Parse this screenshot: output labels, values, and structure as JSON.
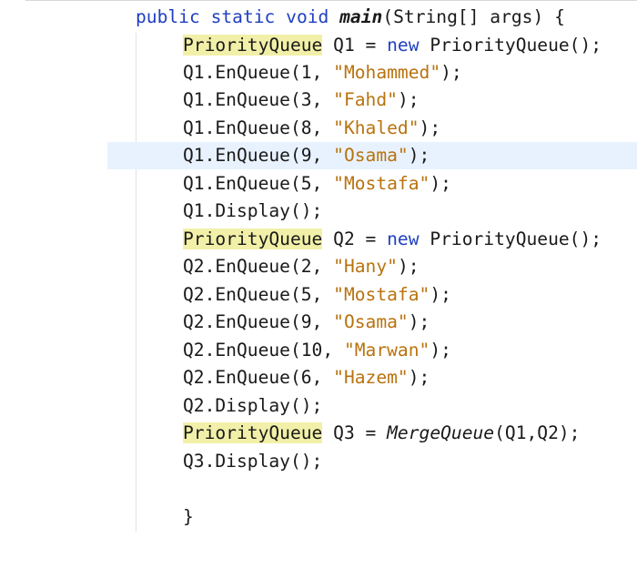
{
  "colors": {
    "keyword": "#1f3fbf",
    "string": "#b8730e",
    "type_highlight": "#f2f0a8",
    "current_line": "#e8f2fe",
    "text": "#1a1a1a"
  },
  "code": {
    "l1": {
      "a": "public static void ",
      "b": "main",
      "c": "(String[] args) {"
    },
    "l2": {
      "a": "PriorityQueue",
      "b": " Q1 = ",
      "c": "new",
      "d": " PriorityQueue();"
    },
    "l3": {
      "a": "Q1.EnQueue(1, ",
      "b": "\"Mohammed\"",
      "c": ");"
    },
    "l4": {
      "a": "Q1.EnQueue(3, ",
      "b": "\"Fahd\"",
      "c": ");"
    },
    "l5": {
      "a": "Q1.EnQueue(8, ",
      "b": "\"Khaled\"",
      "c": ");"
    },
    "l6": {
      "a": "Q1.EnQueue(9, ",
      "b": "\"Osama\"",
      "c": ");"
    },
    "l7": {
      "a": "Q1.EnQueue(5, ",
      "b": "\"Mostafa\"",
      "c": ");"
    },
    "l8": {
      "a": "Q1.Display();"
    },
    "l9": {
      "a": "PriorityQueue",
      "b": " Q2 = ",
      "c": "new",
      "d": " PriorityQueue();"
    },
    "l10": {
      "a": "Q2.EnQueue(2, ",
      "b": "\"Hany\"",
      "c": ");"
    },
    "l11": {
      "a": "Q2.EnQueue(5, ",
      "b": "\"Mostafa\"",
      "c": ");"
    },
    "l12": {
      "a": "Q2.EnQueue(9, ",
      "b": "\"Osama\"",
      "c": ");"
    },
    "l13": {
      "a": "Q2.EnQueue(10, ",
      "b": "\"Marwan\"",
      "c": ");"
    },
    "l14": {
      "a": "Q2.EnQueue(6, ",
      "b": "\"Hazem\"",
      "c": ");"
    },
    "l15": {
      "a": "Q2.Display();"
    },
    "l16": {
      "a": "PriorityQueue",
      "b": " Q3 = ",
      "c": "MergeQueue",
      "d": "(Q1,Q2);"
    },
    "l17": {
      "a": "Q3.Display();"
    },
    "l19": {
      "a": "}"
    }
  }
}
